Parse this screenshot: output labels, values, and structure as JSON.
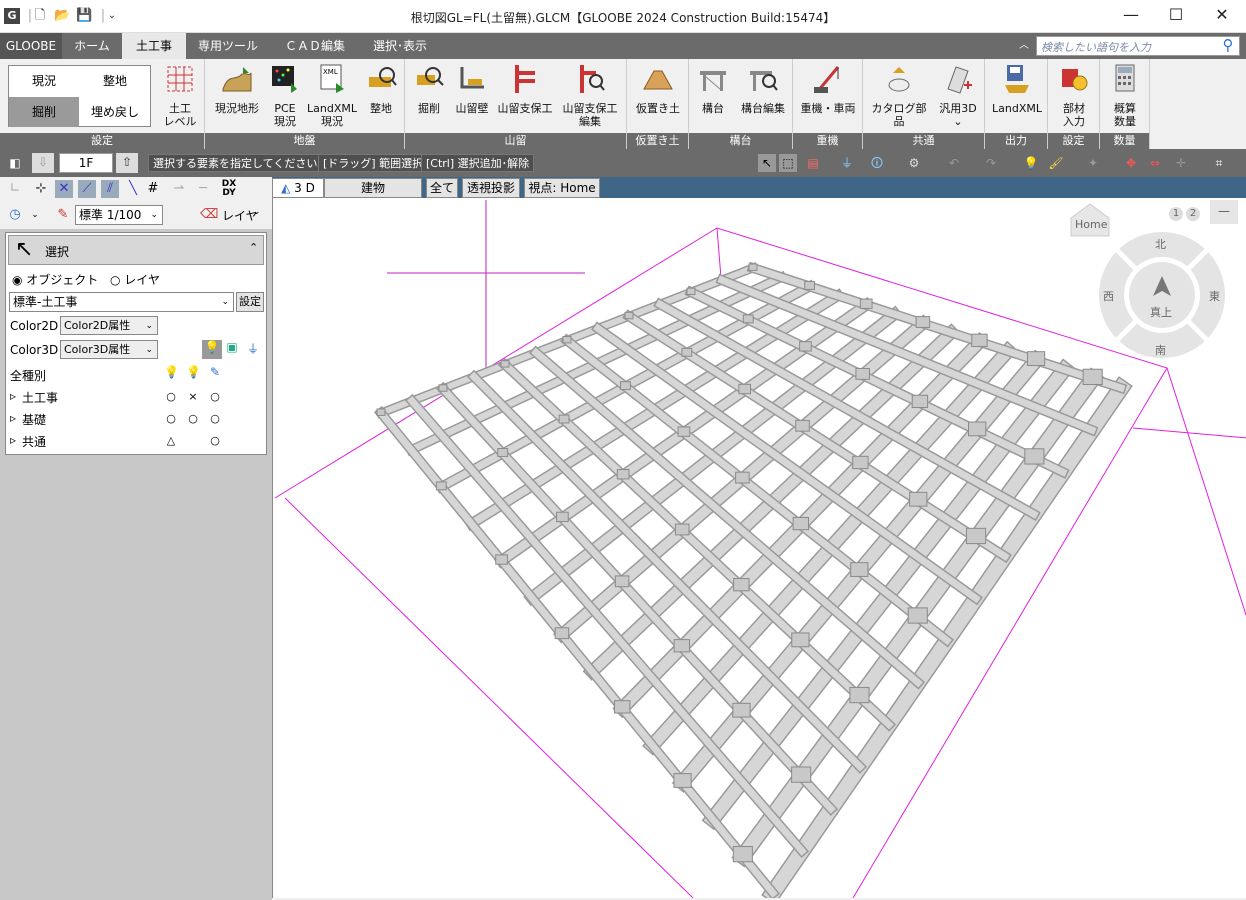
{
  "titlebar": {
    "app_icon": "G",
    "title": "根切図GL=FL(土留無).GLCM【GLOOBE 2024 Construction Build:15474】"
  },
  "menu": {
    "items": [
      "GLOOBE",
      "ホーム",
      "土工事",
      "専用ツール",
      "ＣＡＤ編集",
      "選択･表示"
    ],
    "active": "土工事",
    "search_placeholder": "検索したい語句を入力"
  },
  "ribbon": {
    "settings": {
      "genkyo": "現況",
      "seichi": "整地",
      "kussaku": "掘削",
      "umemodoshi": "埋め戻し",
      "label": "設定"
    },
    "dokou_level": {
      "line1": "土工",
      "line2": "レベル"
    },
    "jiban": {
      "label": "地盤",
      "buttons": [
        {
          "l1": "現況地形",
          "l2": ""
        },
        {
          "l1": "PCE",
          "l2": "現況"
        },
        {
          "l1": "LandXML",
          "l2": "現況"
        },
        {
          "l1": "整地",
          "l2": ""
        }
      ]
    },
    "yamadome": {
      "label": "山留",
      "buttons": [
        {
          "l1": "掘削",
          "l2": ""
        },
        {
          "l1": "山留壁",
          "l2": ""
        },
        {
          "l1": "山留支保工",
          "l2": ""
        },
        {
          "l1": "山留支保工",
          "l2": "編集"
        }
      ]
    },
    "karioki": {
      "label": "仮置き土",
      "buttons": [
        {
          "l1": "仮置き土",
          "l2": ""
        }
      ]
    },
    "kodai": {
      "label": "構台",
      "buttons": [
        {
          "l1": "構台",
          "l2": ""
        },
        {
          "l1": "構台編集",
          "l2": ""
        }
      ]
    },
    "jyuki": {
      "label": "重機",
      "buttons": [
        {
          "l1": "重機・車両",
          "l2": ""
        }
      ]
    },
    "kyotsu": {
      "label": "共通",
      "buttons": [
        {
          "l1": "カタログ部品",
          "l2": ""
        },
        {
          "l1": "汎用3D",
          "l2": "⌄"
        }
      ]
    },
    "output": {
      "label": "出力",
      "buttons": [
        {
          "l1": "LandXML",
          "l2": ""
        }
      ]
    },
    "setting2": {
      "label": "設定",
      "buttons": [
        {
          "l1": "部材",
          "l2": "入力"
        }
      ]
    },
    "quantity": {
      "label": "数量",
      "buttons": [
        {
          "l1": "概算",
          "l2": "数量"
        }
      ]
    }
  },
  "status": {
    "floor": "1F",
    "msg1": "選択する要素を指定してください。",
    "msg2": "[ドラッグ] 範囲選択",
    "msg3": "[Ctrl] 選択追加･解除"
  },
  "leftpanel": {
    "scale": "標準 1/100",
    "layer_btn": "レイヤ",
    "dxdy": "DX DY",
    "select_title": "選択",
    "radio_object": "オブジェクト",
    "radio_layer": "レイヤ",
    "preset": "標準-土工事",
    "preset_btn": "設定",
    "color2d_label": "Color2D",
    "color2d_value": "Color2D属性",
    "color3d_label": "Color3D",
    "color3d_value": "Color3D属性",
    "all_types": "全種別",
    "categories": [
      {
        "name": "土工事",
        "m1": "○",
        "m2": "×",
        "m3": "○"
      },
      {
        "name": "基礎",
        "m1": "○",
        "m2": "○",
        "m3": "○"
      },
      {
        "name": "共通",
        "m1": "△",
        "m2": "",
        "m3": "○"
      }
    ]
  },
  "viewtabs": {
    "tab3d": "3 D",
    "building": "建物",
    "all": "全て",
    "perspective": "透視投影",
    "viewpoint": "視点: Home"
  },
  "navcube": {
    "home": "Home",
    "north": "北",
    "south": "南",
    "east": "東",
    "west": "西",
    "top": "真上",
    "page1": "1",
    "page2": "2"
  }
}
